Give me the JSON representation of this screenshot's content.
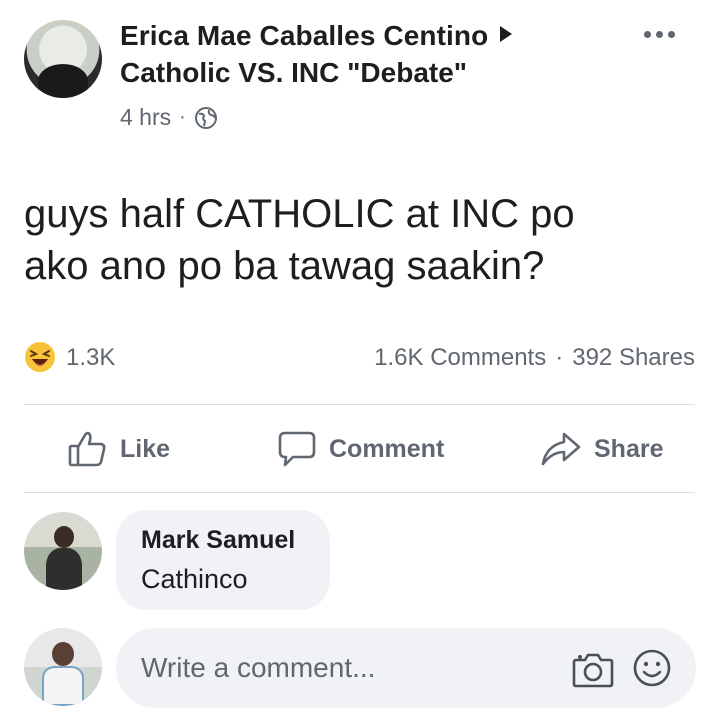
{
  "post": {
    "author": "Erica Mae Caballes Centino",
    "group": "Catholic VS. INC \"Debate\"",
    "time": "4 hrs",
    "dot": "·",
    "text": "guys half CATHOLIC at INC po\nako ano po ba tawag saakin?",
    "reaction_count": "1.3K",
    "comments_count": "1.6K Comments",
    "separator": "·",
    "shares_count": "392 Shares"
  },
  "actions": {
    "like": "Like",
    "comment": "Comment",
    "share": "Share"
  },
  "comments": [
    {
      "name": "Mark Samuel",
      "text": "Cathinco"
    }
  ],
  "composer": {
    "placeholder": "Write a comment..."
  },
  "icons": {
    "more": "more-options-icon",
    "privacy": "globe-icon",
    "reaction": "haha-reaction-icon",
    "like": "thumbs-up-icon",
    "comment": "speech-bubble-icon",
    "share": "share-arrow-icon",
    "camera": "camera-icon",
    "emoji": "smiley-icon"
  },
  "colors": {
    "text_primary": "#1c1e21",
    "text_secondary": "#606770",
    "bubble_bg": "#f0f2f5",
    "divider": "#dadde1",
    "reaction_yellow": "#f7c339"
  }
}
